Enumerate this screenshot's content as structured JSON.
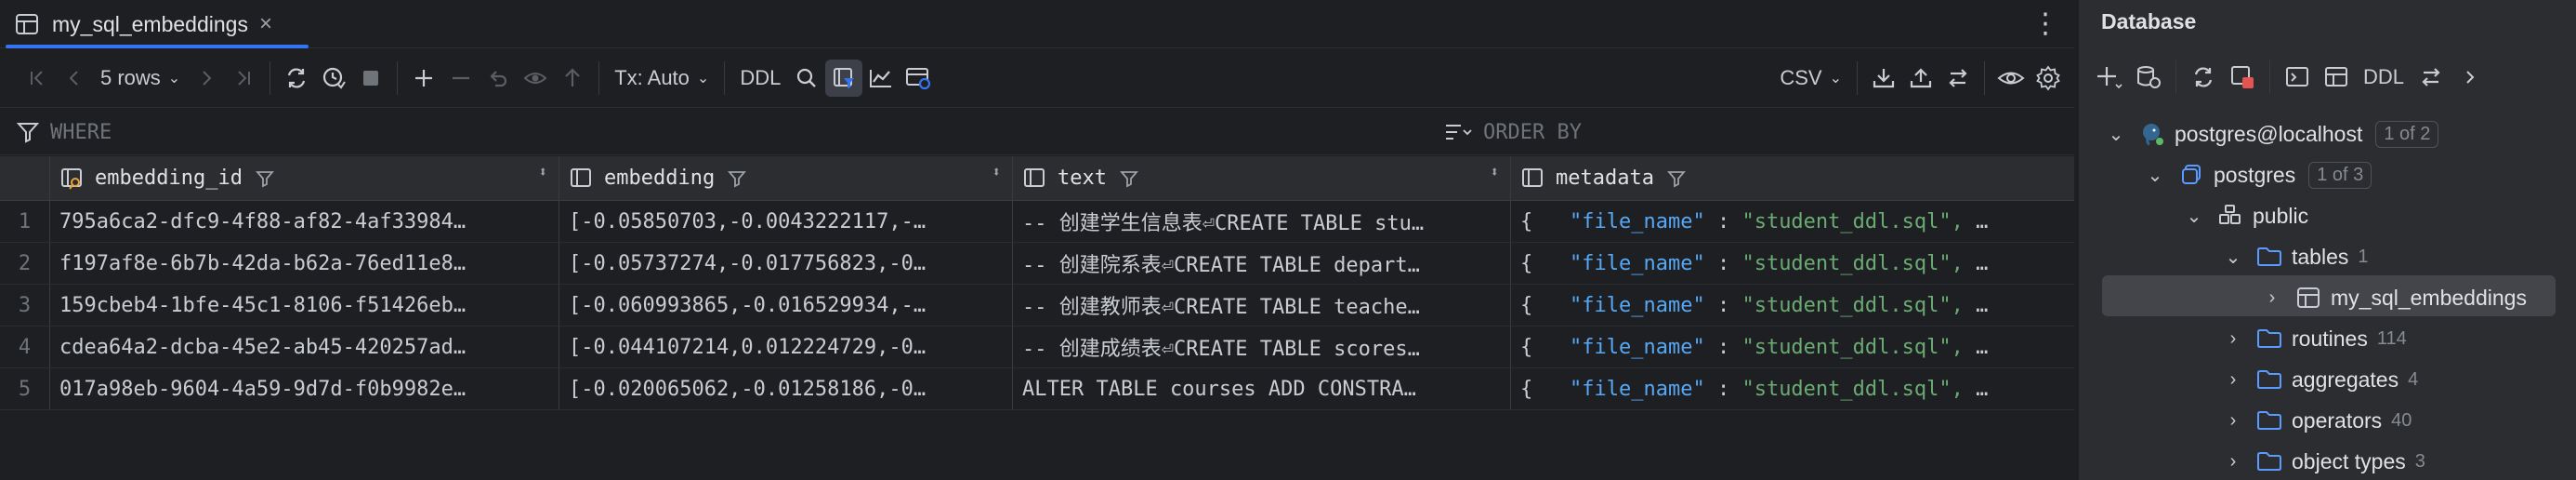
{
  "tab": {
    "title": "my_sql_embeddings",
    "close": "×"
  },
  "toolbar": {
    "rows_label": "5 rows",
    "tx_label": "Tx: Auto",
    "ddl_label": "DDL",
    "export_format": "CSV"
  },
  "filter": {
    "where_label": "WHERE",
    "orderby_label": "ORDER BY"
  },
  "grid": {
    "columns": [
      {
        "name": "embedding_id"
      },
      {
        "name": "embedding"
      },
      {
        "name": "text"
      },
      {
        "name": "metadata"
      }
    ],
    "rows": [
      {
        "n": "1",
        "id": "795a6ca2-dfc9-4f88-af82-4af33984…",
        "embedding": "[-0.05850703,-0.0043222117,-…",
        "text": "-- 创建学生信息表⏎CREATE TABLE stu…",
        "meta_open": "{",
        "meta_key": "\"file_name\"",
        "meta_colon": ":",
        "meta_val": "\"student_ddl.sql\",",
        "meta_more": "…"
      },
      {
        "n": "2",
        "id": "f197af8e-6b7b-42da-b62a-76ed11e8…",
        "embedding": "[-0.05737274,-0.017756823,-0…",
        "text": "-- 创建院系表⏎CREATE TABLE depart…",
        "meta_open": "{",
        "meta_key": "\"file_name\"",
        "meta_colon": ":",
        "meta_val": "\"student_ddl.sql\",",
        "meta_more": "…"
      },
      {
        "n": "3",
        "id": "159cbeb4-1bfe-45c1-8106-f51426eb…",
        "embedding": "[-0.060993865,-0.016529934,-…",
        "text": "-- 创建教师表⏎CREATE TABLE teache…",
        "meta_open": "{",
        "meta_key": "\"file_name\"",
        "meta_colon": ":",
        "meta_val": "\"student_ddl.sql\",",
        "meta_more": "…"
      },
      {
        "n": "4",
        "id": "cdea64a2-dcba-45e2-ab45-420257ad…",
        "embedding": "[-0.044107214,0.012224729,-0…",
        "text": "-- 创建成绩表⏎CREATE TABLE scores…",
        "meta_open": "{",
        "meta_key": "\"file_name\"",
        "meta_colon": ":",
        "meta_val": "\"student_ddl.sql\",",
        "meta_more": "…"
      },
      {
        "n": "5",
        "id": "017a98eb-9604-4a59-9d7d-f0b9982e…",
        "embedding": "[-0.020065062,-0.01258186,-0…",
        "text": "ALTER TABLE courses ADD CONSTRA…",
        "meta_open": "{",
        "meta_key": "\"file_name\"",
        "meta_colon": ":",
        "meta_val": "\"student_ddl.sql\",",
        "meta_more": "…"
      }
    ]
  },
  "database_panel": {
    "title": "Database",
    "ddl_label": "DDL",
    "tree": {
      "server": {
        "label": "postgres@localhost",
        "badge": "1 of 2"
      },
      "database": {
        "label": "postgres",
        "badge": "1 of 3"
      },
      "schema": {
        "label": "public"
      },
      "tables": {
        "label": "tables",
        "count": "1"
      },
      "table": {
        "label": "my_sql_embeddings"
      },
      "routines": {
        "label": "routines",
        "count": "114"
      },
      "aggregates": {
        "label": "aggregates",
        "count": "4"
      },
      "operators": {
        "label": "operators",
        "count": "40"
      },
      "object_types": {
        "label": "object types",
        "count": "3"
      }
    }
  },
  "colors": {
    "accent": "#3574f0",
    "folder": "#5b9bff",
    "json_key": "#56a8f5",
    "json_string": "#6aab73"
  },
  "icons": [
    "table-icon",
    "first-page-icon",
    "prev-page-icon",
    "next-page-icon",
    "last-page-icon",
    "refresh-icon",
    "history-icon",
    "stop-icon",
    "add-row-icon",
    "remove-row-icon",
    "revert-icon",
    "preview-icon",
    "submit-icon",
    "search-icon",
    "filter-icon",
    "chart-icon",
    "view-query-icon",
    "download-icon",
    "upload-icon",
    "compare-icon",
    "eye-icon",
    "gear-icon",
    "folder-icon",
    "elephant-icon",
    "schema-icon"
  ]
}
